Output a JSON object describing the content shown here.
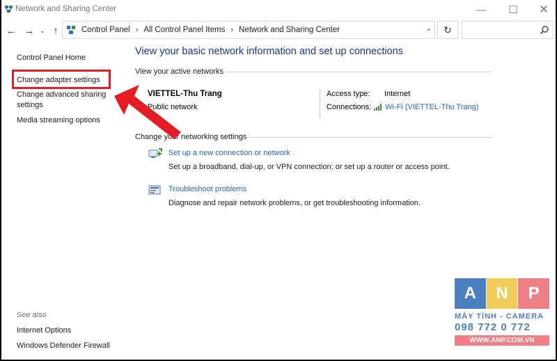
{
  "window": {
    "title": "Network and Sharing Center",
    "controls": {
      "minimize": "—",
      "maximize": "☐",
      "close": "✕"
    }
  },
  "navigation": {
    "back": "←",
    "forward": "→",
    "recent": "⌄",
    "up": "↑",
    "refresh": "↻"
  },
  "address": {
    "crumbs": [
      "Control Panel",
      "All Control Panel Items",
      "Network and Sharing Center"
    ],
    "separator": "›",
    "dropdown": "⌄"
  },
  "search": {
    "value": ""
  },
  "sidebar": {
    "home": "Control Panel Home",
    "links": [
      {
        "label": "Change adapter settings"
      },
      {
        "label": "Change advanced sharing"
      },
      {
        "label": "settings"
      },
      {
        "label": "Media streaming options"
      }
    ],
    "see_also_title": "See also",
    "see_also": [
      {
        "label": "Internet Options"
      },
      {
        "label": "Windows Defender Firewall"
      }
    ]
  },
  "main": {
    "title": "View your basic network information and set up connections",
    "active_networks_label": "View your active networks",
    "network": {
      "name": "VIETTEL-Thu Trang",
      "category": "Public network",
      "access_type_label": "Access type:",
      "access_type_value": "Internet",
      "connections_label": "Connections:",
      "connections_value": "Wi-Fi (VIETTEL-Thu Trang)"
    },
    "change_settings_label": "Change your networking settings",
    "tasks": [
      {
        "link": "Set up a new connection or network",
        "description": "Set up a broadband, dial-up, or VPN connection; or set up a router or access point."
      },
      {
        "link": "Troubleshoot problems",
        "description": "Diagnose and repair network problems, or get troubleshooting information."
      }
    ]
  },
  "watermark": {
    "letters": [
      "A",
      "N",
      "P"
    ],
    "subtitle": "MÁY TÍNH - CAMERA",
    "phone": "098 772 0 772",
    "url": "WWW.ANP.COM.VN"
  },
  "colors": {
    "link": "#2262c6",
    "title": "#1e3287",
    "highlight": "#e41d25",
    "logo_blue": "#4a7fc0",
    "logo_yellow": "#f2cc5a",
    "logo_pink": "#ef7f86"
  }
}
